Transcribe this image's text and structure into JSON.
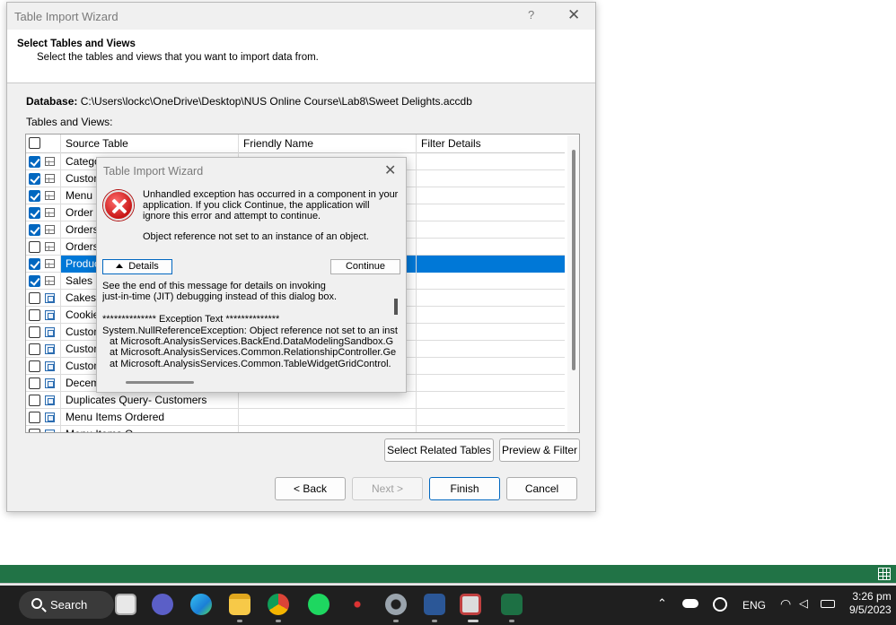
{
  "wizard": {
    "title": "Table Import Wizard",
    "help_glyph": "?",
    "close_glyph": "✕",
    "heading": "Select Tables and Views",
    "subheading": "Select the tables and views that you want to import data from.",
    "database_label": "Database:",
    "database_path": "C:\\Users\\lockc\\OneDrive\\Desktop\\NUS Online Course\\Lab8\\Sweet Delights.accdb",
    "tables_label": "Tables and Views:",
    "columns": {
      "source": "Source Table",
      "friendly": "Friendly Name",
      "filter": "Filter Details"
    },
    "rows": [
      {
        "checked": true,
        "kind": "table",
        "source": "Catego"
      },
      {
        "checked": true,
        "kind": "table",
        "source": "Custom"
      },
      {
        "checked": true,
        "kind": "table",
        "source": "Menu It"
      },
      {
        "checked": true,
        "kind": "table",
        "source": "Order I"
      },
      {
        "checked": true,
        "kind": "table",
        "source": "Orders"
      },
      {
        "checked": false,
        "kind": "table",
        "source": "Orders"
      },
      {
        "checked": true,
        "kind": "table",
        "source": "Produc",
        "selected": true
      },
      {
        "checked": true,
        "kind": "table",
        "source": "Sales U"
      },
      {
        "checked": false,
        "kind": "query",
        "source": "Cakes"
      },
      {
        "checked": false,
        "kind": "query",
        "source": "Cookie"
      },
      {
        "checked": false,
        "kind": "query",
        "source": "Custom"
      },
      {
        "checked": false,
        "kind": "query",
        "source": "Custom"
      },
      {
        "checked": false,
        "kind": "query",
        "source": "Custom"
      },
      {
        "checked": false,
        "kind": "query",
        "source": "Decem"
      },
      {
        "checked": false,
        "kind": "query",
        "source": "Duplicates Query- Customers"
      },
      {
        "checked": false,
        "kind": "query",
        "source": "Menu Items Ordered"
      },
      {
        "checked": false,
        "kind": "query",
        "source": "Menu Items Q"
      }
    ],
    "buttons": {
      "select_related": "Select Related Tables",
      "preview_filter": "Preview & Filter",
      "back": "< Back",
      "next": "Next >",
      "finish": "Finish",
      "cancel": "Cancel"
    }
  },
  "error_dialog": {
    "title": "Table Import Wizard",
    "close_glyph": "✕",
    "message": "Unhandled exception has occurred in a component in your application. If you click Continue, the application will ignore this error and attempt to continue.",
    "message2": "Object reference not set to an instance of an object.",
    "details_label": "Details",
    "continue_label": "Continue",
    "details_lines": [
      "See the end of this message for details on invoking",
      "just-in-time (JIT) debugging instead of this dialog box.",
      "",
      "************** Exception Text **************",
      "System.NullReferenceException: Object reference not set to an inst",
      "at Microsoft.AnalysisServices.BackEnd.DataModelingSandbox.G",
      "at Microsoft.AnalysisServices.Common.RelationshipController.Ge",
      "at Microsoft.AnalysisServices.Common.TableWidgetGridControl."
    ]
  },
  "taskbar": {
    "search_label": "Search",
    "language": "ENG",
    "time": "3:26 pm",
    "date": "9/5/2023"
  },
  "colors": {
    "excel_green": "#217346",
    "selection_blue": "#0078d7",
    "taskbar_bg": "#1f1f1f"
  }
}
